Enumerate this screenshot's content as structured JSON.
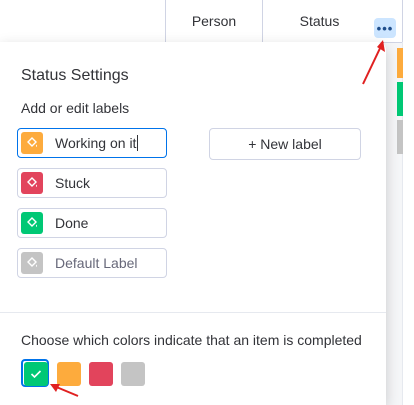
{
  "board": {
    "columns": [
      "Person",
      "Status"
    ],
    "more_icon": "ellipsis-icon"
  },
  "popover": {
    "title": "Status Settings",
    "subtitle": "Add or edit labels",
    "labels": [
      {
        "text": "Working on it",
        "color": "#fdab3d",
        "icon": "paint-bucket-icon",
        "editing": true
      },
      {
        "text": "Stuck",
        "color": "#e2445c",
        "icon": "paint-bucket-icon"
      },
      {
        "text": "Done",
        "color": "#00c875",
        "icon": "paint-bucket-icon"
      },
      {
        "text": "Default Label",
        "color": "#c4c4c4",
        "icon": "paint-bucket-icon"
      }
    ],
    "new_label_button": "+ New label",
    "completed_prompt": "Choose which colors indicate that an item is completed",
    "completed_colors": [
      {
        "color": "#00c875",
        "selected": true
      },
      {
        "color": "#fdab3d",
        "selected": false
      },
      {
        "color": "#e2445c",
        "selected": false
      },
      {
        "color": "#c4c4c4",
        "selected": false
      }
    ]
  },
  "colors": {
    "accent": "#0073ea",
    "annotation_arrow": "#e02020"
  }
}
